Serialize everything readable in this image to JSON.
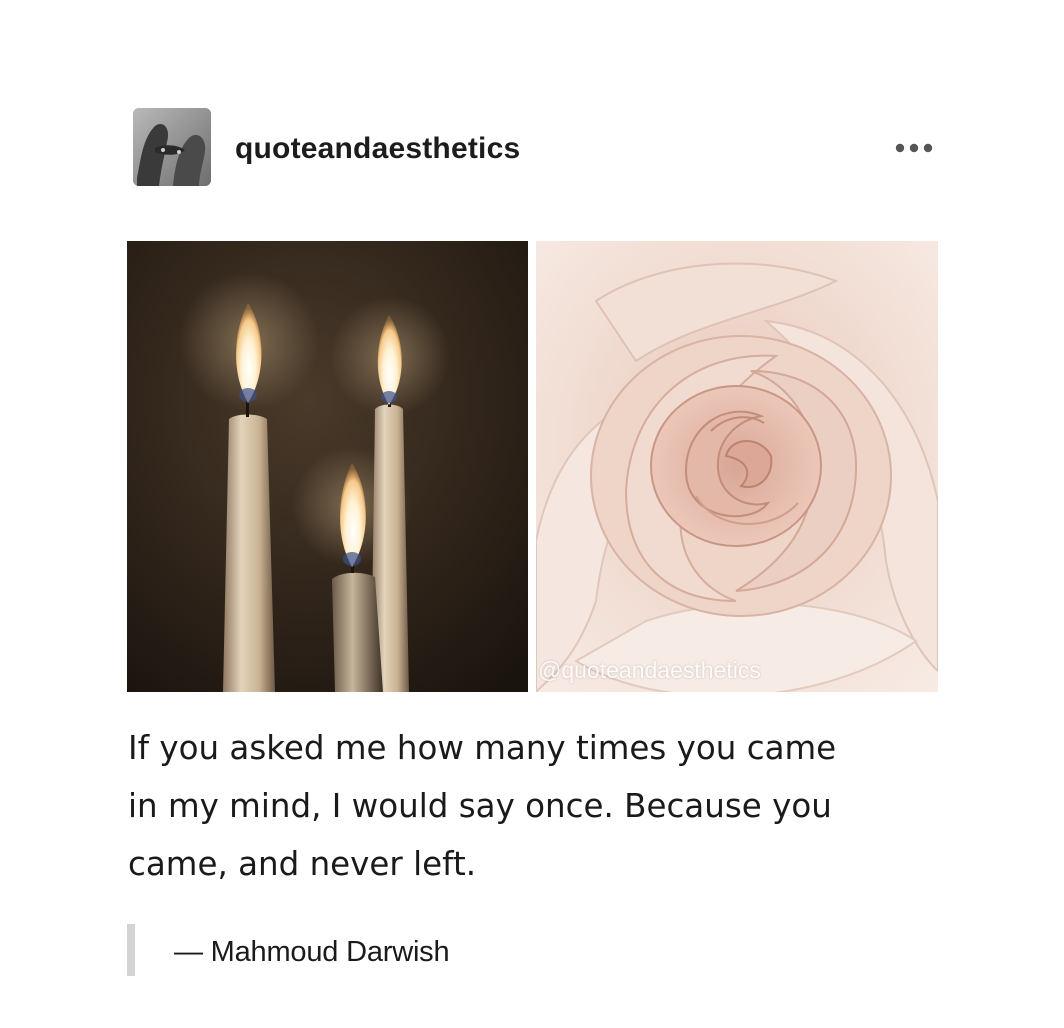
{
  "post": {
    "blog_name": "quoteandaesthetics",
    "more_menu_icon": "ellipsis-icon",
    "images": [
      {
        "name": "candles-photo"
      },
      {
        "name": "rose-photo",
        "watermark": "@quoteandaesthetics"
      }
    ],
    "body_lines": [
      "If you asked me how many times you came",
      "in my mind, I would say once. Because you",
      "came, and never left."
    ],
    "attribution": "— Mahmoud Darwish"
  },
  "colors": {
    "text": "#1a1a1a",
    "quote_bar": "#d4d4d4",
    "background": "#ffffff"
  }
}
